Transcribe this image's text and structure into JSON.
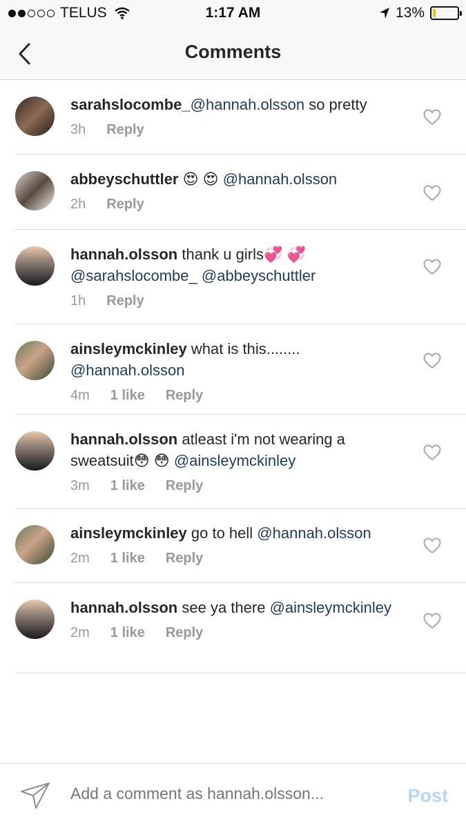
{
  "status_bar": {
    "carrier": "TELUS",
    "time": "1:17 AM",
    "battery": "13%",
    "battery_level": 0.13
  },
  "nav": {
    "title": "Comments"
  },
  "comments": [
    {
      "username": "sarahslocombe_",
      "text": "",
      "mention": "@hannah.olsson",
      "text_after": " so pretty",
      "mention2": "",
      "time": "3h",
      "likes": "",
      "reply": "Reply"
    },
    {
      "username": "abbeyschuttler",
      "text": " 😍 😍 ",
      "mention": "@hannah.olsson",
      "text_after": "",
      "mention2": "",
      "time": "2h",
      "likes": "",
      "reply": "Reply"
    },
    {
      "username": "hannah.olsson",
      "text": " thank u girls💞 💞 ",
      "mention": "@sarahslocombe_",
      "text_after": " ",
      "mention2": "@abbeyschuttler",
      "time": "1h",
      "likes": "",
      "reply": "Reply"
    },
    {
      "username": "ainsleymckinley",
      "text": " what is this........ ",
      "mention": "@hannah.olsson",
      "text_after": "",
      "mention2": "",
      "time": "4m",
      "likes": "1 like",
      "reply": "Reply"
    },
    {
      "username": "hannah.olsson",
      "text": " atleast i'm not wearing a sweatsuit😳 😳 ",
      "mention": "@ainsleymckinley",
      "text_after": "",
      "mention2": "",
      "time": "3m",
      "likes": "1 like",
      "reply": "Reply"
    },
    {
      "username": "ainsleymckinley",
      "text": " go to hell ",
      "mention": "@hannah.olsson",
      "text_after": "",
      "mention2": "",
      "time": "2m",
      "likes": "1 like",
      "reply": "Reply"
    },
    {
      "username": "hannah.olsson",
      "text": " see ya there ",
      "mention": "@ainsleymckinley",
      "text_after": "",
      "mention2": "",
      "time": "2m",
      "likes": "1 like",
      "reply": "Reply"
    }
  ],
  "compose": {
    "placeholder": "Add a comment as hannah.olsson...",
    "post_label": "Post"
  },
  "colors": {
    "mention": "#1d3a5f",
    "meta": "#999999",
    "post_disabled": "#b3d7f7",
    "battery": "#f2c200"
  },
  "icons": {
    "back": "chevron-left-icon",
    "like": "heart-outline-icon",
    "send": "paper-plane-icon",
    "wifi": "wifi-icon",
    "location": "location-arrow-icon"
  }
}
